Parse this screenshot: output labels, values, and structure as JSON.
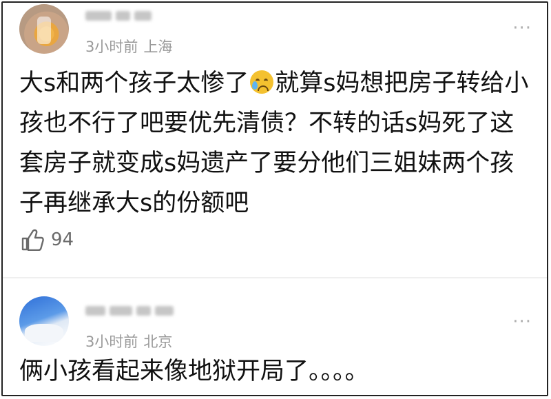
{
  "comments": [
    {
      "time": "3小时前",
      "location": "上海",
      "text_before_emoji": "大s和两个孩子太惨了",
      "emoji": "crying-face-emoji",
      "text_after_emoji": "就算s妈想把房子转给小孩也不行了吧要优先清债？不转的话s妈死了这套房子就变成s妈遗产了要分他们三姐妹两个孩子再继承大s的份额吧",
      "likes": "94",
      "more": "···"
    },
    {
      "time": "3小时前",
      "location": "北京",
      "text": "俩小孩看起来像地狱开局了。。。。",
      "more": "···"
    }
  ],
  "colors": {
    "meta_text": "#9a9a9a",
    "body_text": "#111111",
    "like_icon": "#6a6a6a"
  }
}
